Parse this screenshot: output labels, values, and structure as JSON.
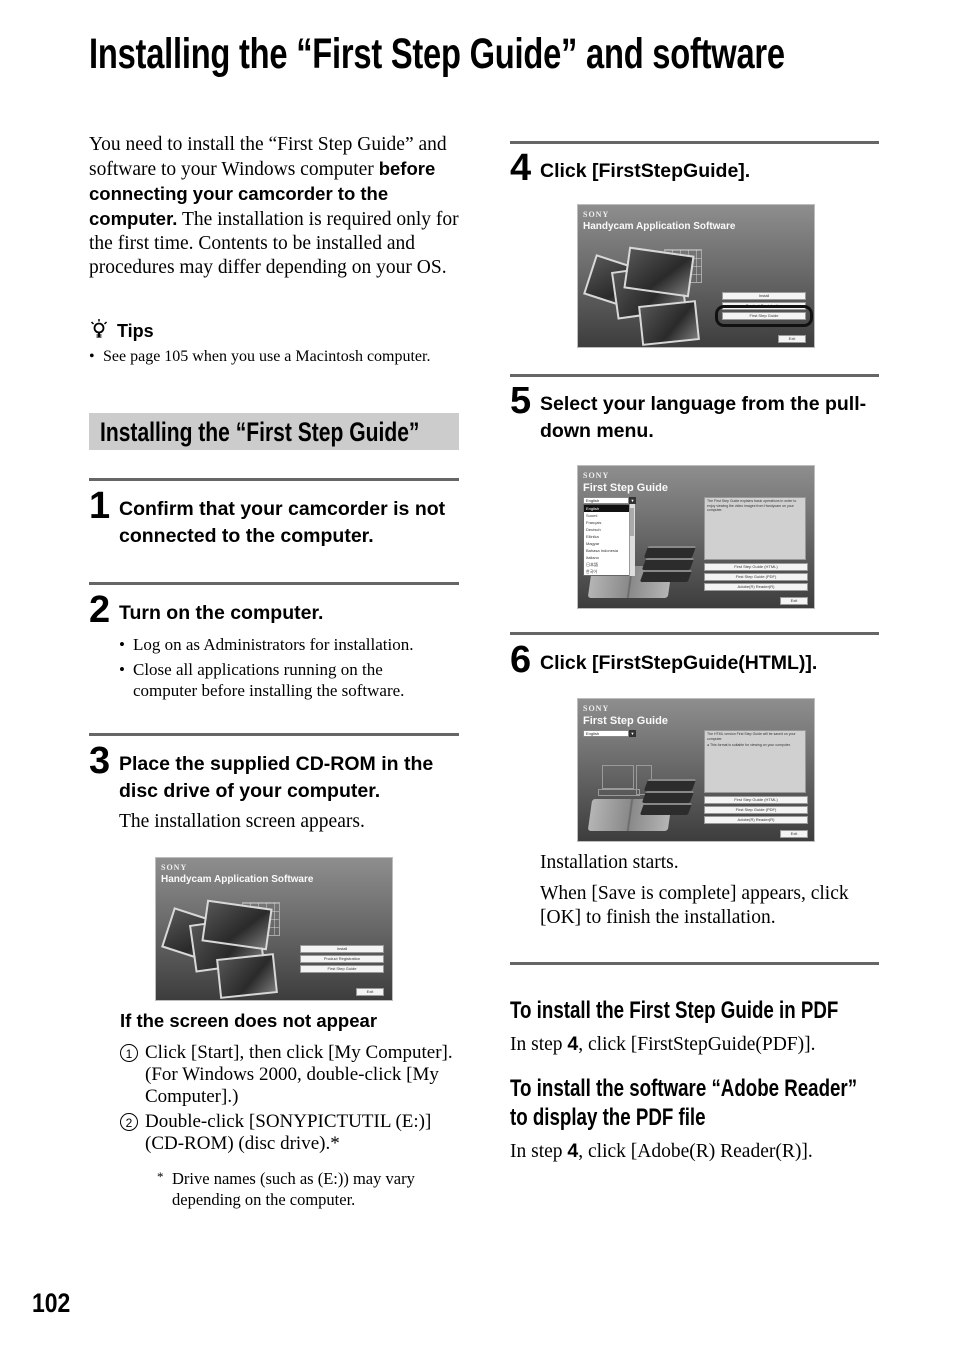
{
  "page": {
    "title": "Installing the “First Step Guide” and software",
    "page_number": "102"
  },
  "intro": {
    "part1": "You need to install the “First Step Guide” and software to your Windows computer ",
    "bold": "before connecting your camcorder to the computer.",
    "part2": " The installation is required only for the first time. Contents to be installed and procedures may differ depending on your OS."
  },
  "tips": {
    "label": "Tips",
    "items": [
      "See page 105 when you use a Macintosh computer."
    ]
  },
  "section": {
    "title": "Installing the “First Step Guide”"
  },
  "steps": [
    {
      "number": "1",
      "title": "Confirm that your camcorder is not connected to the computer."
    },
    {
      "number": "2",
      "title": "Turn on the computer.",
      "bullets": [
        "Log on as Administrators for installation.",
        "Close all applications running on the computer before installing the software."
      ]
    },
    {
      "number": "3",
      "title": "Place the supplied CD-ROM in the disc drive of your computer.",
      "text": "The installation screen appears.",
      "troubleshoot": {
        "heading": "If the screen does not appear",
        "items": [
          {
            "marker": "1",
            "text": "Click [Start], then click [My Computer]. (For Windows 2000, double-click [My Computer].)"
          },
          {
            "marker": "2",
            "text": "Double-click [SONYPICTUTIL (E:)] (CD-ROM) (disc drive).*"
          }
        ],
        "footnote_marker": "*",
        "footnote": "Drive names (such as (E:)) may vary depending on the computer."
      }
    },
    {
      "number": "4",
      "title": "Click [FirstStepGuide]."
    },
    {
      "number": "5",
      "title": "Select your language from the pull-down menu."
    },
    {
      "number": "6",
      "title": "Click [FirstStepGuide(HTML)].",
      "after_texts": [
        "Installation starts.",
        "When [Save is complete] appears, click [OK] to finish the installation."
      ]
    }
  ],
  "screens": {
    "handycam": {
      "brand": "SONY",
      "title": "Handycam Application Software",
      "buttons": [
        "Install",
        "Product Registration",
        "First Step Guide"
      ],
      "exit": "Exit"
    },
    "fsg_language": {
      "brand": "SONY",
      "title": "First Step Guide",
      "selected_language": "English",
      "languages": [
        "English",
        "Suomi",
        "Français",
        "Deutsch",
        "Ellinika",
        "Magyar",
        "Bahasa Indonesia",
        "Italiano",
        "日本語",
        "한국어"
      ],
      "info": "The First Step Guide explains basic operations in order to enjoy viewing the video images from Handycam on your computer.",
      "buttons": [
        "First Step Guide (HTML)",
        "First Step Guide (PDF)",
        "Adobe(R) Reader(R)"
      ],
      "exit": "Exit"
    },
    "fsg_html": {
      "brand": "SONY",
      "title": "First Step Guide",
      "selected_language": "English",
      "info_line1": "The HTML version First Step Guide will be saved on your computer.",
      "info_line2": "● This format is suitable for viewing on your computer.",
      "buttons": [
        "First Step Guide (HTML)",
        "First Step Guide (PDF)",
        "Adobe(R) Reader(R)"
      ],
      "exit": "Exit"
    }
  },
  "extras": [
    {
      "heading": "To install the First Step Guide in PDF",
      "pre": "In step ",
      "step_ref": "4",
      "post": ", click [FirstStepGuide(PDF)]."
    },
    {
      "heading": "To install the software “Adobe Reader” to display the PDF file",
      "pre": "In step ",
      "step_ref": "4",
      "post": ", click [Adobe(R) Reader(R)]."
    }
  ],
  "colors": {
    "rule": "#666666",
    "section_band": "#cccccc",
    "text": "#000000"
  }
}
